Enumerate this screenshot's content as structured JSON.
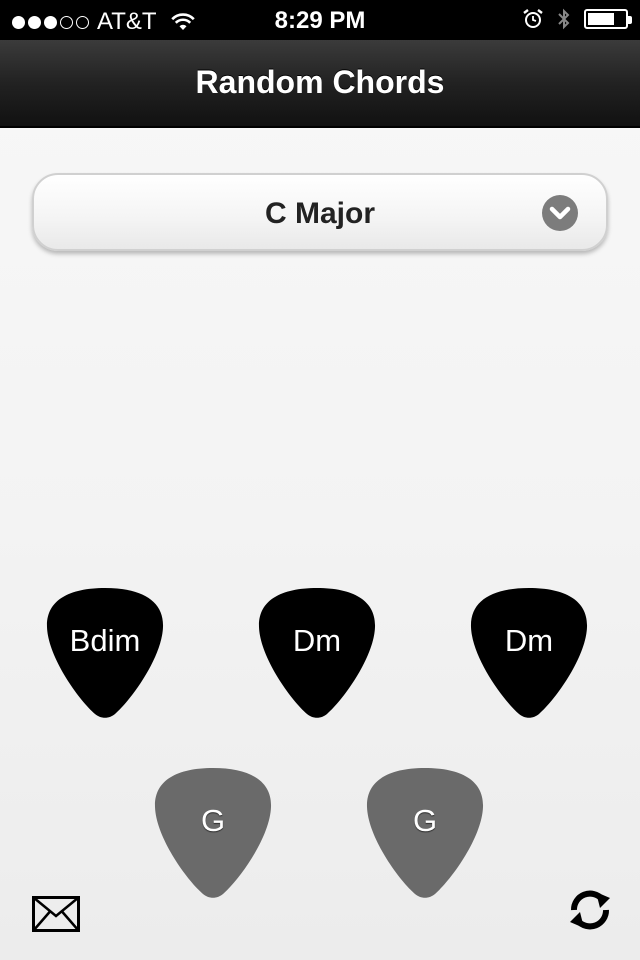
{
  "status_bar": {
    "signal_bars_filled": 3,
    "signal_bars_total": 5,
    "carrier": "AT&T",
    "time": "8:29 PM",
    "battery_level": 0.75,
    "icons": [
      "wifi-icon",
      "alarm-icon",
      "bluetooth-icon",
      "battery-icon"
    ]
  },
  "navbar": {
    "title": "Random Chords"
  },
  "key_selector": {
    "value": "C Major",
    "icon": "chevron-down-icon"
  },
  "picks": {
    "row1": [
      {
        "label": "Bdim",
        "color": "#000000"
      },
      {
        "label": "Dm",
        "color": "#000000"
      },
      {
        "label": "Dm",
        "color": "#000000"
      }
    ],
    "row2": [
      {
        "label": "G",
        "color": "#6a6a6a"
      },
      {
        "label": "G",
        "color": "#6a6a6a"
      }
    ]
  },
  "toolbar": {
    "mail_icon": "envelope-icon",
    "refresh_icon": "refresh-icon"
  },
  "colors": {
    "accent_dark": "#000000",
    "pick_gray": "#6a6a6a",
    "background": "#f4f4f4"
  }
}
